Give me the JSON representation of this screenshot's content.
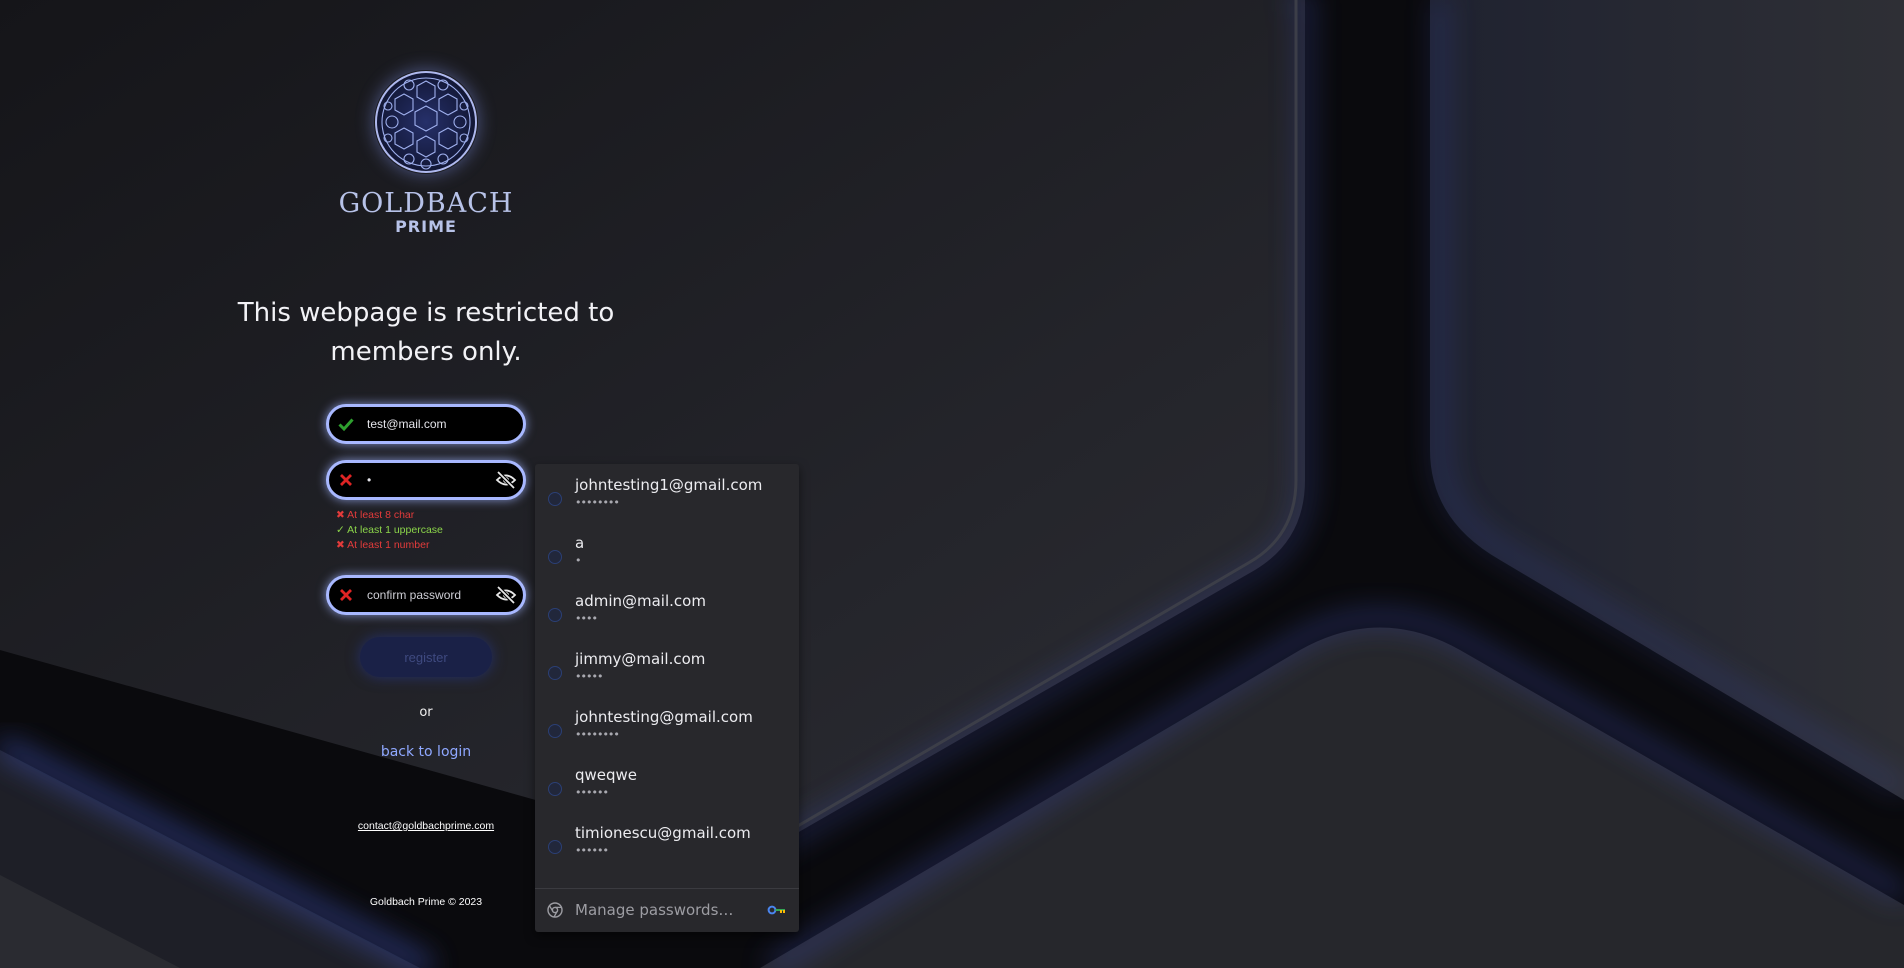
{
  "brand": {
    "name": "GOLDBACH",
    "sub": "PRIME"
  },
  "headline": "This webpage is restricted to members only.",
  "form": {
    "email": {
      "value": "test@mail.com",
      "status": "valid",
      "status_icon": "check-icon"
    },
    "password": {
      "value": "•",
      "status": "invalid",
      "status_icon": "x-icon",
      "toggle_icon": "eye-slash-icon"
    },
    "rules": [
      {
        "mark": "✖",
        "text": "At least 8 char",
        "ok": false
      },
      {
        "mark": "✓",
        "text": "At least 1 uppercase",
        "ok": true
      },
      {
        "mark": "✖",
        "text": "At least 1 number",
        "ok": false
      }
    ],
    "confirm": {
      "placeholder": "confirm password",
      "status": "invalid",
      "status_icon": "x-icon",
      "toggle_icon": "eye-slash-icon"
    },
    "register_label": "register"
  },
  "or_text": "or",
  "back_to_login": "back to login",
  "contact_email": "contact@goldbachprime.com",
  "footer": "Goldbach Prime © 2023",
  "autofill": {
    "items": [
      {
        "username": "johntesting1@gmail.com",
        "mask": "••••••••"
      },
      {
        "username": "a",
        "mask": "•"
      },
      {
        "username": "admin@mail.com",
        "mask": "••••"
      },
      {
        "username": "jimmy@mail.com",
        "mask": "•••••"
      },
      {
        "username": "johntesting@gmail.com",
        "mask": "••••••••"
      },
      {
        "username": "qweqwe",
        "mask": "••••••"
      },
      {
        "username": "timionescu@gmail.com",
        "mask": "••••••"
      }
    ],
    "manage_label": "Manage passwords…",
    "manage_icon": "chrome-icon",
    "key_icon": "key-icon"
  },
  "colors": {
    "accent": "#a8b8ff",
    "link": "#8fa8ff",
    "valid": "#2fa02f",
    "invalid": "#e02424",
    "rule_ok": "#8bd44a",
    "rule_fail": "#e33b3b",
    "dropdown_bg": "#28282c"
  }
}
